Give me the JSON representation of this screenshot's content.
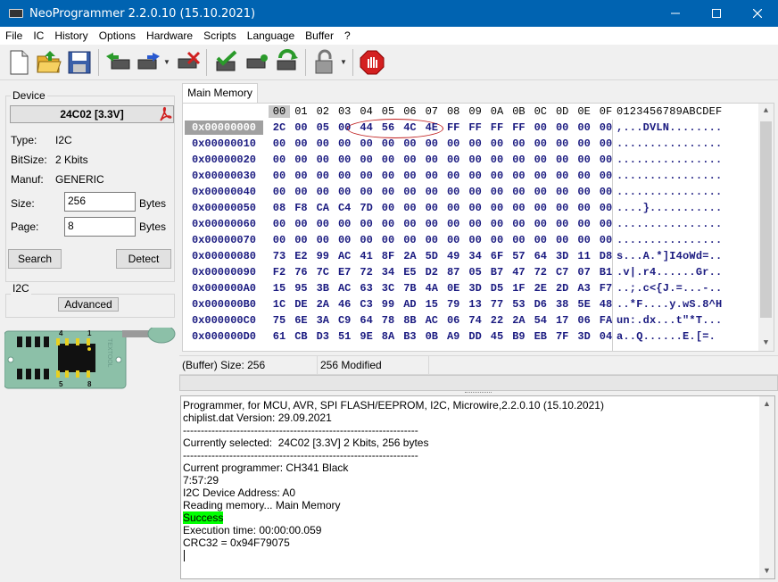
{
  "window": {
    "title": "NeoProgrammer 2.2.0.10 (15.10.2021)",
    "controls": {
      "minimize": "—",
      "maximize": "☐",
      "close": "✕"
    }
  },
  "menu": [
    "File",
    "IC",
    "History",
    "Options",
    "Hardware",
    "Scripts",
    "Language",
    "Buffer",
    "?"
  ],
  "toolbar": {
    "icons": [
      "new-file-icon",
      "open-folder-icon",
      "save-floppy-icon",
      "read-chip-icon",
      "write-chip-icon",
      "erase-chip-icon",
      "verify-chip-icon",
      "blank-check-icon",
      "auto-icon",
      "lock-icon",
      "stop-icon"
    ]
  },
  "device": {
    "group_label": "Device",
    "chip": "24C02 [3.3V]",
    "type_label": "Type:",
    "type_value": "I2C",
    "bitsize_label": "BitSize:",
    "bitsize_value": "2 Kbits",
    "manuf_label": "Manuf:",
    "manuf_value": "GENERIC",
    "size_label": "Size:",
    "size_value": "256",
    "size_unit": "Bytes",
    "page_label": "Page:",
    "page_value": "8",
    "page_unit": "Bytes",
    "search_button": "Search",
    "detect_button": "Detect"
  },
  "i2c": {
    "group_label": "I2C",
    "advanced_button": "Advanced"
  },
  "chip_image": {
    "pin_top_left": "4",
    "pin_top_right": "1",
    "pin_bottom_left": "5",
    "pin_bottom_right": "8",
    "brand": "TEXTOOL"
  },
  "tabs": [
    "Main Memory"
  ],
  "hex": {
    "columns": [
      "00",
      "01",
      "02",
      "03",
      "04",
      "05",
      "06",
      "07",
      "08",
      "09",
      "0A",
      "0B",
      "0C",
      "0D",
      "0E",
      "0F"
    ],
    "ascii_header": "0123456789ABCDEF",
    "rows": [
      {
        "addr": "0x00000000",
        "bytes": [
          "2C",
          "00",
          "05",
          "00",
          "44",
          "56",
          "4C",
          "4E",
          "FF",
          "FF",
          "FF",
          "FF",
          "00",
          "00",
          "00",
          "00"
        ],
        "ascii": ",...DVLN........"
      },
      {
        "addr": "0x00000010",
        "bytes": [
          "00",
          "00",
          "00",
          "00",
          "00",
          "00",
          "00",
          "00",
          "00",
          "00",
          "00",
          "00",
          "00",
          "00",
          "00",
          "00"
        ],
        "ascii": "................"
      },
      {
        "addr": "0x00000020",
        "bytes": [
          "00",
          "00",
          "00",
          "00",
          "00",
          "00",
          "00",
          "00",
          "00",
          "00",
          "00",
          "00",
          "00",
          "00",
          "00",
          "00"
        ],
        "ascii": "................"
      },
      {
        "addr": "0x00000030",
        "bytes": [
          "00",
          "00",
          "00",
          "00",
          "00",
          "00",
          "00",
          "00",
          "00",
          "00",
          "00",
          "00",
          "00",
          "00",
          "00",
          "00"
        ],
        "ascii": "................"
      },
      {
        "addr": "0x00000040",
        "bytes": [
          "00",
          "00",
          "00",
          "00",
          "00",
          "00",
          "00",
          "00",
          "00",
          "00",
          "00",
          "00",
          "00",
          "00",
          "00",
          "00"
        ],
        "ascii": "................"
      },
      {
        "addr": "0x00000050",
        "bytes": [
          "08",
          "F8",
          "CA",
          "C4",
          "7D",
          "00",
          "00",
          "00",
          "00",
          "00",
          "00",
          "00",
          "00",
          "00",
          "00",
          "00"
        ],
        "ascii": "....}..........."
      },
      {
        "addr": "0x00000060",
        "bytes": [
          "00",
          "00",
          "00",
          "00",
          "00",
          "00",
          "00",
          "00",
          "00",
          "00",
          "00",
          "00",
          "00",
          "00",
          "00",
          "00"
        ],
        "ascii": "................"
      },
      {
        "addr": "0x00000070",
        "bytes": [
          "00",
          "00",
          "00",
          "00",
          "00",
          "00",
          "00",
          "00",
          "00",
          "00",
          "00",
          "00",
          "00",
          "00",
          "00",
          "00"
        ],
        "ascii": "................"
      },
      {
        "addr": "0x00000080",
        "bytes": [
          "73",
          "E2",
          "99",
          "AC",
          "41",
          "8F",
          "2A",
          "5D",
          "49",
          "34",
          "6F",
          "57",
          "64",
          "3D",
          "11",
          "D8"
        ],
        "ascii": "s...A.*]I4oWd=.."
      },
      {
        "addr": "0x00000090",
        "bytes": [
          "F2",
          "76",
          "7C",
          "E7",
          "72",
          "34",
          "E5",
          "D2",
          "87",
          "05",
          "B7",
          "47",
          "72",
          "C7",
          "07",
          "B1"
        ],
        "ascii": ".v|.r4......Gr.."
      },
      {
        "addr": "0x000000A0",
        "bytes": [
          "15",
          "95",
          "3B",
          "AC",
          "63",
          "3C",
          "7B",
          "4A",
          "0E",
          "3D",
          "D5",
          "1F",
          "2E",
          "2D",
          "A3",
          "F7"
        ],
        "ascii": "..;.c<{J.=...-.."
      },
      {
        "addr": "0x000000B0",
        "bytes": [
          "1C",
          "DE",
          "2A",
          "46",
          "C3",
          "99",
          "AD",
          "15",
          "79",
          "13",
          "77",
          "53",
          "D6",
          "38",
          "5E",
          "48"
        ],
        "ascii": "..*F....y.wS.8^H"
      },
      {
        "addr": "0x000000C0",
        "bytes": [
          "75",
          "6E",
          "3A",
          "C9",
          "64",
          "78",
          "8B",
          "AC",
          "06",
          "74",
          "22",
          "2A",
          "54",
          "17",
          "06",
          "FA"
        ],
        "ascii": "un:.dx...t\"*T..."
      },
      {
        "addr": "0x000000D0",
        "bytes": [
          "61",
          "CB",
          "D3",
          "51",
          "9E",
          "8A",
          "B3",
          "0B",
          "A9",
          "DD",
          "45",
          "B9",
          "EB",
          "7F",
          "3D",
          "04"
        ],
        "ascii": "a..Q......E.[=."
      }
    ]
  },
  "status": {
    "buffer_size": "(Buffer) Size: 256",
    "modified": "256 Modified"
  },
  "log": {
    "lines": [
      "Programmer, for MCU, AVR, SPI FLASH/EEPROM, I2C, Microwire,2.2.0.10 (15.10.2021)",
      "chiplist.dat Version: 29.09.2021",
      "------------------------------------------------------------------",
      "Currently selected:  24C02 [3.3V] 2 Kbits, 256 bytes",
      "------------------------------------------------------------------",
      "Current programmer: CH341 Black",
      "7:57:29",
      "I2C Device Address: A0",
      "Reading memory... Main Memory",
      "Success",
      "Execution time: 00:00:00.059",
      "CRC32 = 0x94F79075"
    ]
  }
}
